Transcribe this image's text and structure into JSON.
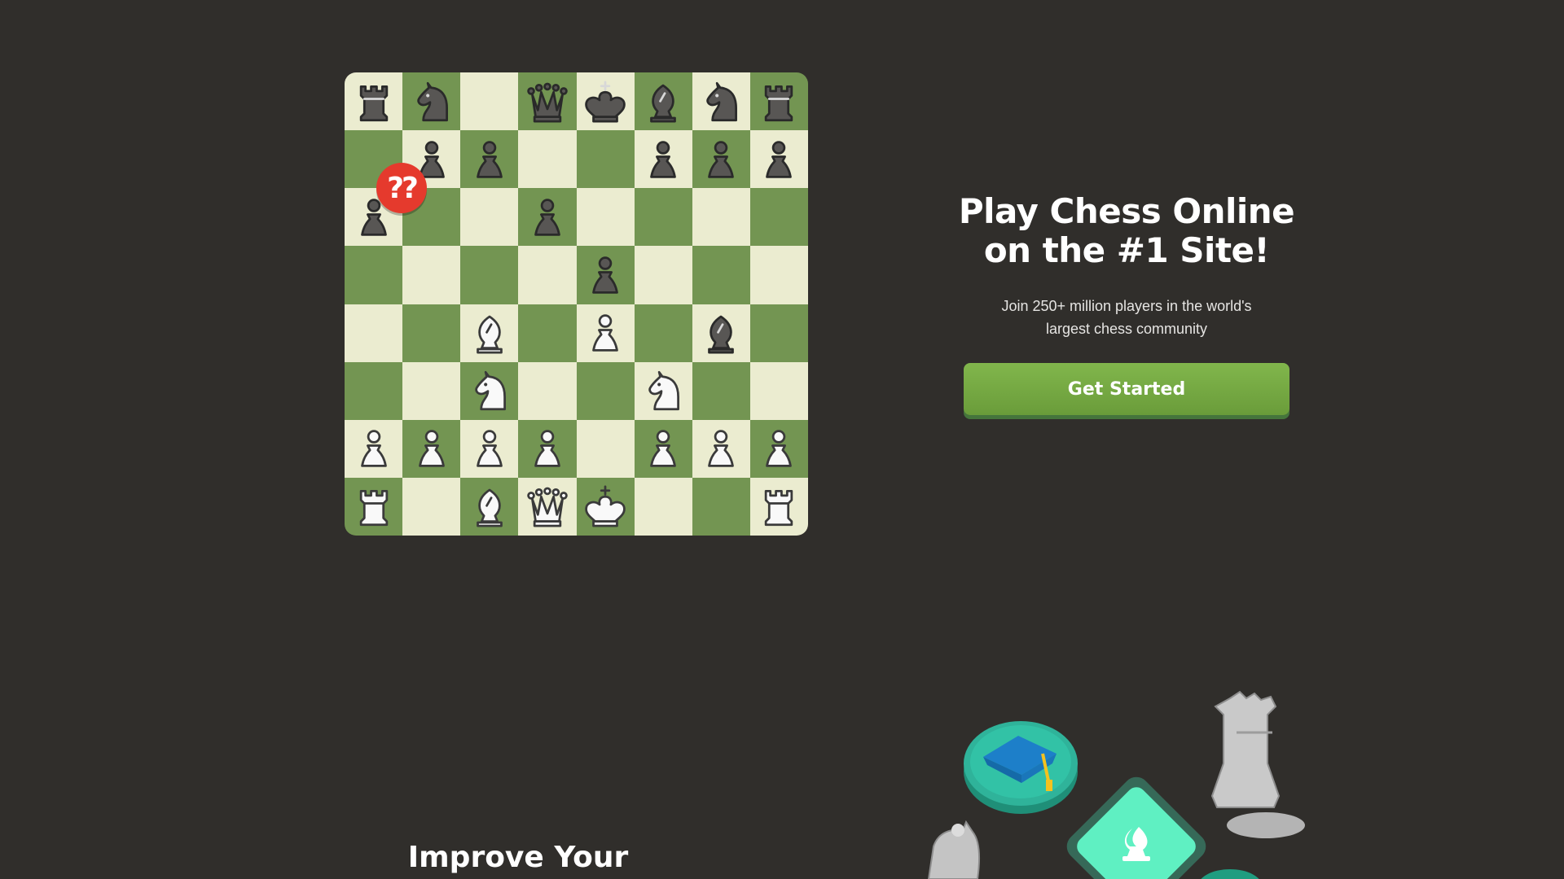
{
  "board": {
    "ranks": [
      [
        "br",
        "bn",
        "",
        "bq",
        "bk",
        "bb",
        "bn",
        "br"
      ],
      [
        "",
        "bp",
        "bp",
        "",
        "",
        "bp",
        "bp",
        "bp"
      ],
      [
        "bp",
        "",
        "",
        "bp",
        "",
        "",
        "",
        ""
      ],
      [
        "",
        "",
        "",
        "",
        "bp",
        "",
        "",
        ""
      ],
      [
        "",
        "",
        "wb",
        "",
        "wp",
        "",
        "bb",
        ""
      ],
      [
        "",
        "",
        "wn",
        "",
        "",
        "wn",
        "",
        ""
      ],
      [
        "wp",
        "wp",
        "wp",
        "wp",
        "",
        "wp",
        "wp",
        "wp"
      ],
      [
        "wr",
        "",
        "wb",
        "wq",
        "wk",
        "",
        "",
        "wr"
      ]
    ],
    "colors": {
      "light": "#ebecd0",
      "dark": "#739552"
    },
    "blunder_badge": "??"
  },
  "hero": {
    "title_line1": "Play Chess Online",
    "title_line2": "on the #1 Site!",
    "subtitle": "Join 250+ million players in the world's largest chess community",
    "cta_label": "Get Started",
    "cta_color": "#81b64c"
  },
  "section2": {
    "heading": "Improve Your"
  },
  "illustration": {
    "icons": [
      "graduation-cap-icon",
      "bishop-tile-icon",
      "rook-statue-icon",
      "knight-statue-icon"
    ]
  }
}
